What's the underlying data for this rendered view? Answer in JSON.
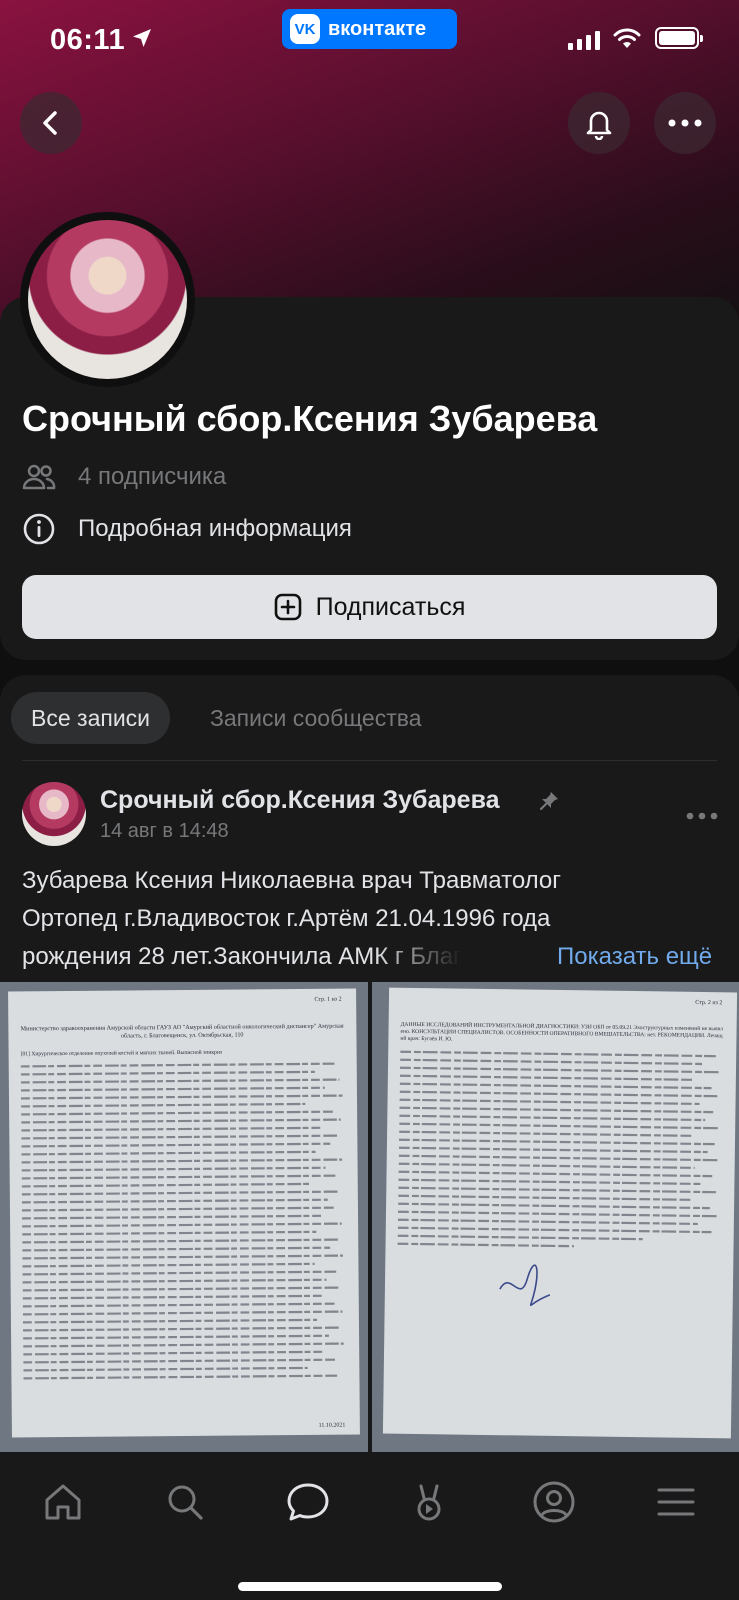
{
  "status_bar": {
    "time": "06:11",
    "app_badge": "вконтакте",
    "app_badge_logo": "VK"
  },
  "group": {
    "name": "Срочный сбор.Ксения Зубарева",
    "subscribers": "4 подписчика",
    "details": "Подробная информация",
    "subscribe_label": "Подписаться"
  },
  "tabs": [
    {
      "label": "Все записи",
      "active": true
    },
    {
      "label": "Записи сообщества",
      "active": false
    }
  ],
  "post": {
    "author": "Срочный сбор.Ксения Зубарева",
    "date": "14 авг в 14:48",
    "text_lines": [
      "Зубарева Ксения Николаевна врач Травматолог",
      "Ортопед г.Владивосток г.Артём 21.04.1996 года",
      "рождения 28 лет.Закончила АМК г Благ"
    ],
    "show_more": "Показать ещё",
    "photos": [
      {
        "page": "Стр. 1 из 2",
        "header": "Министерство здравоохранения Амурской области ГАУЗ АО \"Амурский областной онкологический диспансер\" Амурская область, г. Благовещенск, ул. Октябрьская, 110",
        "dept": "[01] Хирургическое отделение опухолей костей и мягких тканей. Выписной эпикриз",
        "date": "11.10.2021"
      },
      {
        "page": "Стр. 2 из 2",
        "header": "ДАННЫЕ ИССЛЕДОВАНИЙ ИНСТРУМЕНТАЛЬНОЙ ДИАГНОСТИКИ: УЗИ ОБП от 05.09.21 Эхоструктурных изменений не выявлено. КОНСУЛЬТАЦИИ СПЕЦИАЛИСТОВ. ОСОБЕННОСТИ ОПЕРАТИВНОГО ВМЕШАТЕЛЬСТВА: нет. РЕКОМЕНДАЦИИ. Лечащий врач: Бугаёв И. Ю."
      }
    ]
  },
  "icons": {
    "back": "chevron-left-icon",
    "bell": "bell-icon",
    "more": "more-icon",
    "subscribers": "users-icon",
    "info": "info-icon",
    "plus": "plus-square-icon",
    "pin": "pin-icon"
  },
  "bottom_nav": [
    "home",
    "search",
    "messenger",
    "clips",
    "profile",
    "menu"
  ]
}
